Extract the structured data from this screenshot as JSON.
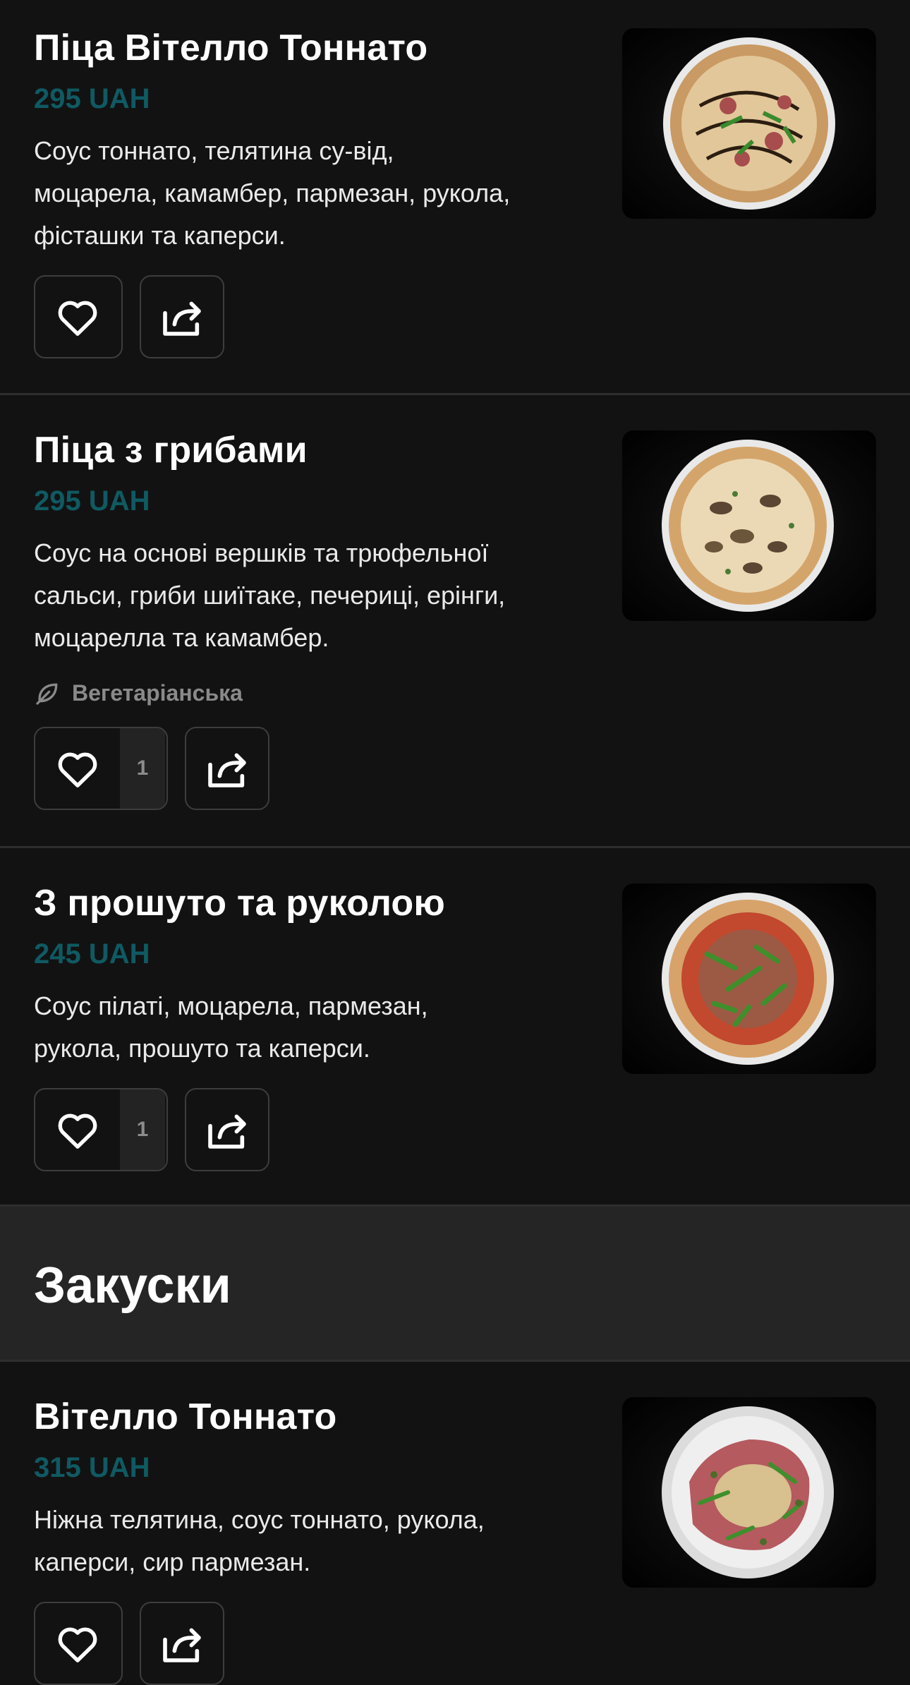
{
  "menu": {
    "items": [
      {
        "name": "Піца Вітелло Тоннато",
        "price": "295 UAH",
        "description_lines": [
          "Соус тоннато, телятина су-від,",
          "моцарела, камамбер, пармезан, рукола,",
          "фісташки та каперси."
        ],
        "like_count": null
      },
      {
        "name": "Піца з грибами",
        "price": "295 UAH",
        "description_lines": [
          "Соус на основі вершків та трюфельної",
          "сальси, гриби шиїтаке, печериці, ерінги,",
          "моцарелла та камамбер."
        ],
        "tag": "Вегетаріанська",
        "like_count": "1"
      },
      {
        "name": "З прошуто та руколою",
        "price": "245 UAH",
        "description_lines": [
          "Соус пілаті, моцарела, пармезан,",
          "рукола, прошуто та каперси."
        ],
        "like_count": "1"
      }
    ],
    "section": {
      "title": "Закуски",
      "items": [
        {
          "name": "Вітелло Тоннато",
          "price": "315 UAH",
          "description_lines": [
            "Ніжна телятина, соус тоннато, рукола,",
            "каперси, сир пармезан."
          ]
        }
      ]
    }
  },
  "colors": {
    "price": "#0f5a63",
    "background": "#121212",
    "section_background": "#252525"
  },
  "icons": [
    "heart-icon",
    "share-icon",
    "leaf-icon"
  ]
}
